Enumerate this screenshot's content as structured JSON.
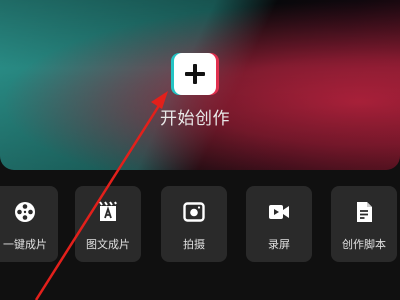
{
  "hero": {
    "create_label": "开始创作",
    "button_icon": "plus-icon"
  },
  "tools": [
    {
      "label": "一键成片",
      "icon": "film-reel-icon"
    },
    {
      "label": "图文成片",
      "icon": "text-document-icon"
    },
    {
      "label": "拍摄",
      "icon": "camera-icon"
    },
    {
      "label": "录屏",
      "icon": "video-record-icon"
    },
    {
      "label": "创作脚本",
      "icon": "script-document-icon"
    }
  ],
  "colors": {
    "background": "#101010",
    "tile": "#2a2a2a",
    "teal_accent": "#25c4c4",
    "red_accent": "#e0304f",
    "annotation_arrow": "#e3201b"
  }
}
